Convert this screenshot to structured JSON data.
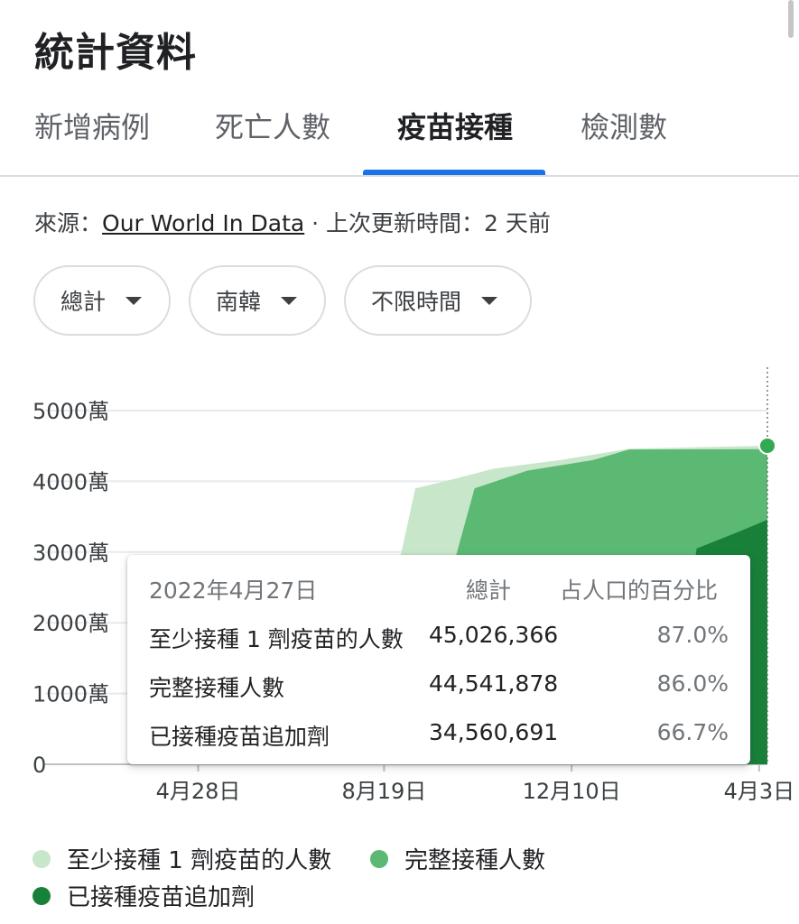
{
  "page": {
    "title": "統計資料"
  },
  "tabs": [
    {
      "label": "新增病例",
      "active": false
    },
    {
      "label": "死亡人數",
      "active": false
    },
    {
      "label": "疫苗接種",
      "active": true
    },
    {
      "label": "檢測數",
      "active": false
    }
  ],
  "source": {
    "prefix": "來源：",
    "link": "Our World In Data",
    "suffix": " · 上次更新時間：2 天前"
  },
  "filters": [
    {
      "label": "總計"
    },
    {
      "label": "南韓"
    },
    {
      "label": "不限時間"
    }
  ],
  "colors": {
    "accent": "#1a73e8",
    "series_light": "#c8e6c9",
    "series_mid": "#5bb974",
    "series_dark": "#188038"
  },
  "chart_data": {
    "type": "area",
    "y_unit": "萬",
    "ylim": [
      0,
      5000
    ],
    "y_ticks": [
      {
        "value": 0,
        "label": "0"
      },
      {
        "value": 1000,
        "label": "1000萬"
      },
      {
        "value": 2000,
        "label": "2000萬"
      },
      {
        "value": 3000,
        "label": "3000萬"
      },
      {
        "value": 4000,
        "label": "4000萬"
      },
      {
        "value": 5000,
        "label": "5000萬"
      }
    ],
    "x_ticks": [
      "4月28日",
      "8月19日",
      "12月10日",
      "4月3日"
    ],
    "x_tick_days": [
      0,
      113,
      227,
      341
    ],
    "x_range_days": [
      -93,
      346
    ],
    "grid": true,
    "legend_position": "bottom",
    "series": [
      {
        "name": "至少接種 1 劑疫苗的人數",
        "color": "#c8e6c9",
        "points": [
          [
            -93,
            0
          ],
          [
            0,
            0
          ],
          [
            103,
            0
          ],
          [
            118,
            2400
          ],
          [
            132,
            3900
          ],
          [
            150,
            4000
          ],
          [
            180,
            4180
          ],
          [
            220,
            4300
          ],
          [
            262,
            4460
          ],
          [
            346,
            4503
          ]
        ]
      },
      {
        "name": "完整接種人數",
        "color": "#5bb974",
        "points": [
          [
            -93,
            0
          ],
          [
            0,
            0
          ],
          [
            145,
            0
          ],
          [
            155,
            2800
          ],
          [
            168,
            3900
          ],
          [
            200,
            4150
          ],
          [
            240,
            4300
          ],
          [
            262,
            4450
          ],
          [
            346,
            4454
          ]
        ]
      },
      {
        "name": "已接種疫苗追加劑",
        "color": "#188038",
        "points": [
          [
            -93,
            0
          ],
          [
            0,
            0
          ],
          [
            280,
            0
          ],
          [
            293,
            1500
          ],
          [
            303,
            3050
          ],
          [
            330,
            3300
          ],
          [
            346,
            3456
          ]
        ]
      }
    ]
  },
  "tooltip": {
    "headers": {
      "date": "2022年4月27日",
      "total": "總計",
      "percent": "占人口的百分比"
    },
    "rows": [
      {
        "name": "至少接種 1 劑疫苗的人數",
        "value": "45,026,366",
        "percent": "87.0%"
      },
      {
        "name": "完整接種人數",
        "value": "44,541,878",
        "percent": "86.0%"
      },
      {
        "name": "已接種疫苗追加劑",
        "value": "34,560,691",
        "percent": "66.7%"
      }
    ]
  },
  "legend": [
    {
      "label": "至少接種 1 劑疫苗的人數",
      "color": "#c8e6c9"
    },
    {
      "label": "完整接種人數",
      "color": "#5bb974"
    },
    {
      "label": "已接種疫苗追加劑",
      "color": "#188038"
    }
  ]
}
